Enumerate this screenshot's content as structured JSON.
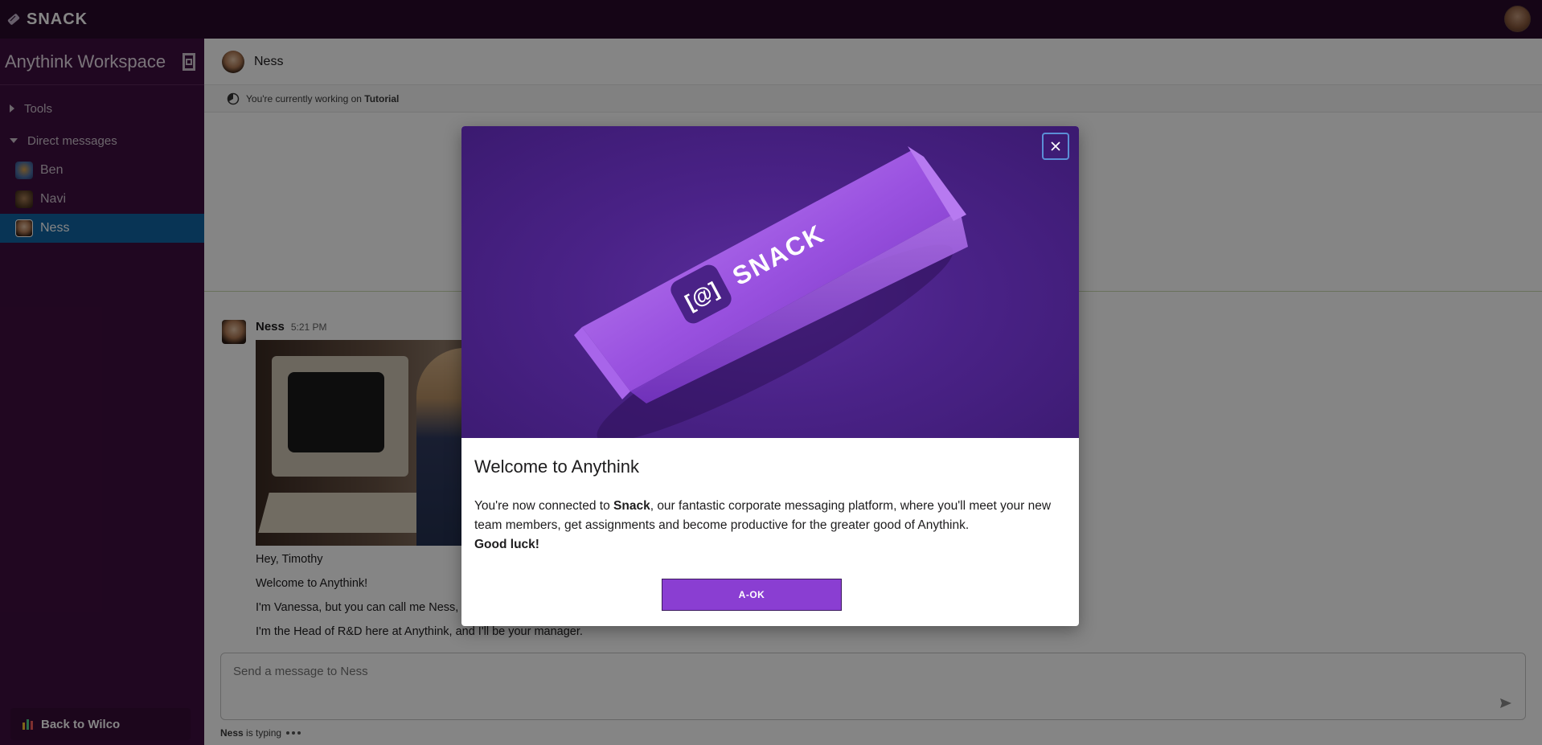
{
  "app": {
    "name": "SNACK"
  },
  "sidebar": {
    "workspace_title": "Anythink Workspace",
    "sections": [
      {
        "label": "Tools",
        "expanded": false
      },
      {
        "label": "Direct messages",
        "expanded": true
      }
    ],
    "direct_messages": [
      {
        "label": "Ben",
        "active": false
      },
      {
        "label": "Navi",
        "active": false
      },
      {
        "label": "Ness",
        "active": true
      }
    ],
    "back_label": "Back to Wilco"
  },
  "channel": {
    "name": "Ness",
    "working_prefix": "You're currently working on",
    "working_project": "Tutorial"
  },
  "message": {
    "author": "Ness",
    "time": "5:21 PM",
    "lines": [
      "Hey, Timothy",
      "Welcome to Anythink!",
      "I'm Vanessa, but you can call me Ness, c",
      "I'm the Head of R&D here at Anythink, and I'll be your manager."
    ]
  },
  "composer": {
    "placeholder": "Send a message to Ness"
  },
  "typing": {
    "name": "Ness",
    "text": "is typing"
  },
  "modal": {
    "hero_product_text": "SNACK",
    "title": "Welcome to Anythink",
    "body_part1": "You're now connected to",
    "body_bold": "Snack",
    "body_part2": ", our fantastic corporate messaging platform, where you'll meet your new team members, get assignments and become productive for the greater good of Anythink.",
    "body_closing": "Good luck!",
    "button_label": "A-OK"
  },
  "colors": {
    "topbar": "#2a0b2b",
    "sidebar": "#3f0e40",
    "active_item": "#1164a3",
    "modal_hero": "#4a2287",
    "button": "#8a3ed2"
  }
}
